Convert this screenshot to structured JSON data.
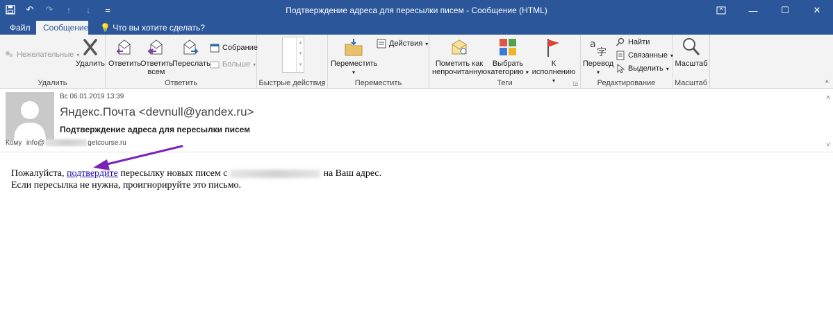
{
  "window": {
    "title": "Подтверждение адреса для пересылки писем - Сообщение (HTML)"
  },
  "tabs": {
    "file": "Файл",
    "message": "Сообщение",
    "tell_me": "Что вы хотите сделать?"
  },
  "ribbon": {
    "delete_group": {
      "label": "Удалить",
      "junk": "Нежелательные",
      "delete": "Удалить"
    },
    "respond_group": {
      "label": "Ответить",
      "reply": "Ответить",
      "reply_all_line1": "Ответить",
      "reply_all_line2": "всем",
      "forward": "Переслать",
      "meeting": "Собрание",
      "more": "Больше"
    },
    "quick_steps_group": {
      "label": "Быстрые действия"
    },
    "move_group": {
      "label": "Переместить",
      "move": "Переместить",
      "actions": "Действия"
    },
    "tags_group": {
      "label": "Теги",
      "mark_unread_line1": "Пометить как",
      "mark_unread_line2": "непрочитанную",
      "categorize_line1": "Выбрать",
      "categorize_line2": "категорию",
      "follow_up": "К исполнению"
    },
    "editing_group": {
      "label": "Редактирование",
      "translate": "Перевод",
      "find": "Найти",
      "related": "Связанные",
      "select": "Выделить"
    },
    "zoom_group": {
      "label": "Масштаб",
      "zoom": "Масштаб"
    }
  },
  "message": {
    "date": "Вс 06.01.2019 13:39",
    "sender": "Яндекс.Почта <devnull@yandex.ru>",
    "subject": "Подтверждение адреса для пересылки писем",
    "to_label": "Кому",
    "to_prefix": "info@",
    "to_suffix": "getcourse.ru",
    "body": {
      "line1_start": "Пожалуйста,",
      "link_text": "подтвердите",
      "line1_mid": "пересылку новых писем с",
      "line1_end": "на Ваш адрес.",
      "line2": "Если пересылка не нужна, проигнорируйте это письмо."
    }
  },
  "colors": {
    "brand": "#2b579a",
    "ribbon_bg": "#f3f3f3",
    "annotation_arrow": "#7b22b8",
    "link": "#1a0dab"
  }
}
